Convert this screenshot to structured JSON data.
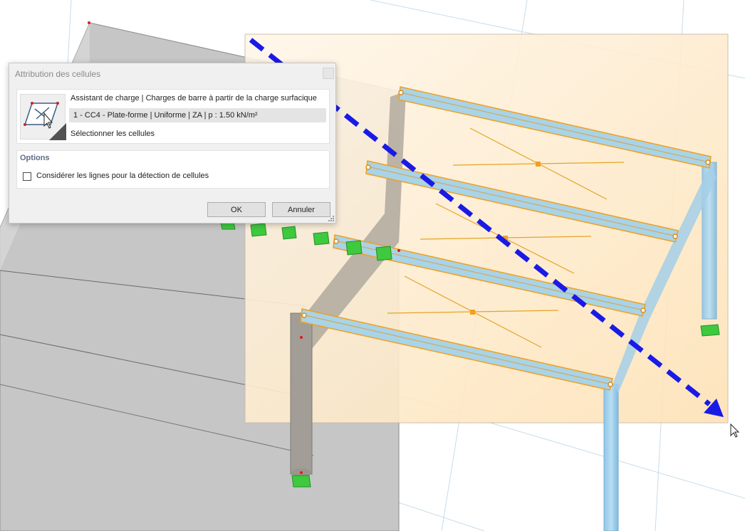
{
  "dialog": {
    "title": "Attribution des cellules",
    "load_wizard_label": "Assistant de charge | Charges de barre à partir de la charge surfacique",
    "load_case_value": "1 - CC4 - Plate-forme | Uniforme | ZA | p : 1.50 kN/m²",
    "select_cells_label": "Sélectionner les cellules",
    "options_header": "Options",
    "consider_lines_label": "Considérer les lignes pour la détection de cellules",
    "consider_lines_checked": false,
    "ok_label": "OK",
    "cancel_label": "Annuler"
  },
  "icons": {
    "select_cells_icon": "cell-select-icon",
    "close_icon": "close-icon",
    "cursor_icon": "mouse-cursor-icon",
    "resize_grip": "resize-grip-icon"
  },
  "colors": {
    "beam_fill": "#a9d3e6",
    "beam_outline": "#f0a020",
    "selection_fill": "#fde6c0",
    "drag_arrow": "#1a1ae6",
    "support": "#3ec93e",
    "column_grey": "#9b9b9b"
  }
}
